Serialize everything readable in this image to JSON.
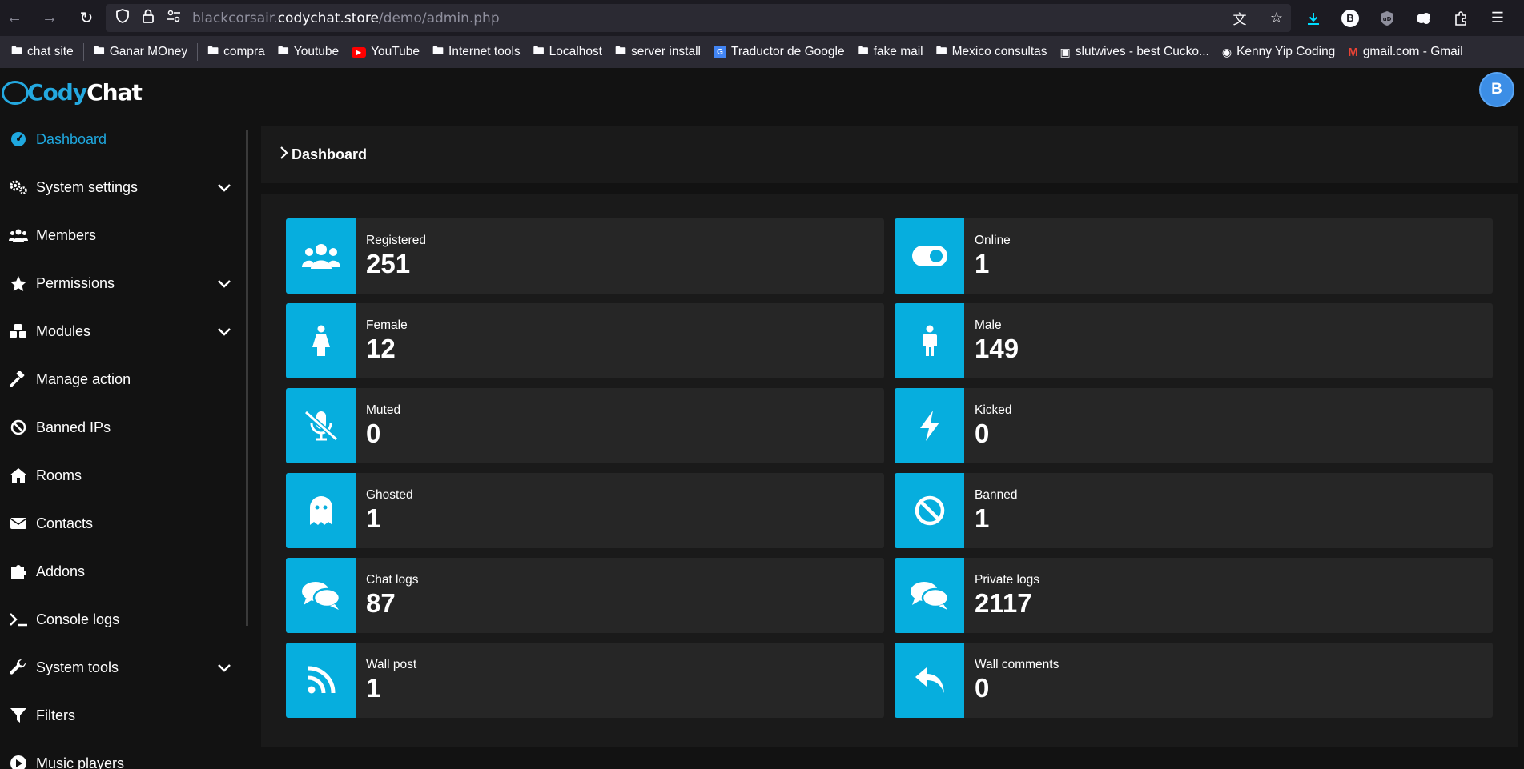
{
  "browser": {
    "url_prefix": "blackcorsair.",
    "url_domain": "codychat.store",
    "url_path": "/demo/admin.php",
    "profile_badge": "B",
    "bookmarks": [
      {
        "label": "chat site",
        "icon": "folder-icon"
      },
      {
        "label": "Ganar MOney",
        "icon": "folder-icon"
      },
      {
        "label": "compra",
        "icon": "folder-icon"
      },
      {
        "label": "Youtube",
        "icon": "folder-icon"
      },
      {
        "label": "YouTube",
        "icon": "youtube-icon"
      },
      {
        "label": "Internet tools",
        "icon": "folder-icon"
      },
      {
        "label": "Localhost",
        "icon": "folder-icon"
      },
      {
        "label": "server install",
        "icon": "folder-icon"
      },
      {
        "label": "Traductor de Google",
        "icon": "google-translate-icon"
      },
      {
        "label": "fake mail",
        "icon": "folder-icon"
      },
      {
        "label": "Mexico consultas",
        "icon": "folder-icon"
      },
      {
        "label": "slutwives - best Cucko...",
        "icon": "site-favicon"
      },
      {
        "label": "Kenny Yip Coding",
        "icon": "site-favicon"
      },
      {
        "label": "gmail.com - Gmail",
        "icon": "gmail-icon"
      }
    ]
  },
  "app": {
    "logo_part1": "Cody",
    "logo_part2": "Chat",
    "avatar_letter": "B",
    "accent": "#06aede"
  },
  "sidebar": {
    "items": [
      {
        "label": "Dashboard",
        "icon": "dashboard-icon",
        "active": true
      },
      {
        "label": "System settings",
        "icon": "cogs-icon",
        "chevron": true
      },
      {
        "label": "Members",
        "icon": "users-icon"
      },
      {
        "label": "Permissions",
        "icon": "star-icon",
        "chevron": true
      },
      {
        "label": "Modules",
        "icon": "cubes-icon",
        "chevron": true
      },
      {
        "label": "Manage action",
        "icon": "gavel-icon"
      },
      {
        "label": "Banned IPs",
        "icon": "ban-icon"
      },
      {
        "label": "Rooms",
        "icon": "home-icon"
      },
      {
        "label": "Contacts",
        "icon": "envelope-icon"
      },
      {
        "label": "Addons",
        "icon": "puzzle-icon"
      },
      {
        "label": "Console logs",
        "icon": "terminal-icon"
      },
      {
        "label": "System tools",
        "icon": "wrench-icon",
        "chevron": true
      },
      {
        "label": "Filters",
        "icon": "filter-icon"
      },
      {
        "label": "Music players",
        "icon": "music-icon"
      }
    ]
  },
  "main": {
    "breadcrumb": "Dashboard",
    "stats": [
      {
        "label": "Registered",
        "value": "251",
        "icon": "users-icon"
      },
      {
        "label": "Online",
        "value": "1",
        "icon": "toggle-icon"
      },
      {
        "label": "Female",
        "value": "12",
        "icon": "female-icon"
      },
      {
        "label": "Male",
        "value": "149",
        "icon": "male-icon"
      },
      {
        "label": "Muted",
        "value": "0",
        "icon": "mic-off-icon"
      },
      {
        "label": "Kicked",
        "value": "0",
        "icon": "bolt-icon"
      },
      {
        "label": "Ghosted",
        "value": "1",
        "icon": "ghost-icon"
      },
      {
        "label": "Banned",
        "value": "1",
        "icon": "ban-icon"
      },
      {
        "label": "Chat logs",
        "value": "87",
        "icon": "comments-icon"
      },
      {
        "label": "Private logs",
        "value": "2117",
        "icon": "comments-icon"
      },
      {
        "label": "Wall post",
        "value": "1",
        "icon": "rss-icon"
      },
      {
        "label": "Wall comments",
        "value": "0",
        "icon": "reply-icon"
      }
    ]
  }
}
